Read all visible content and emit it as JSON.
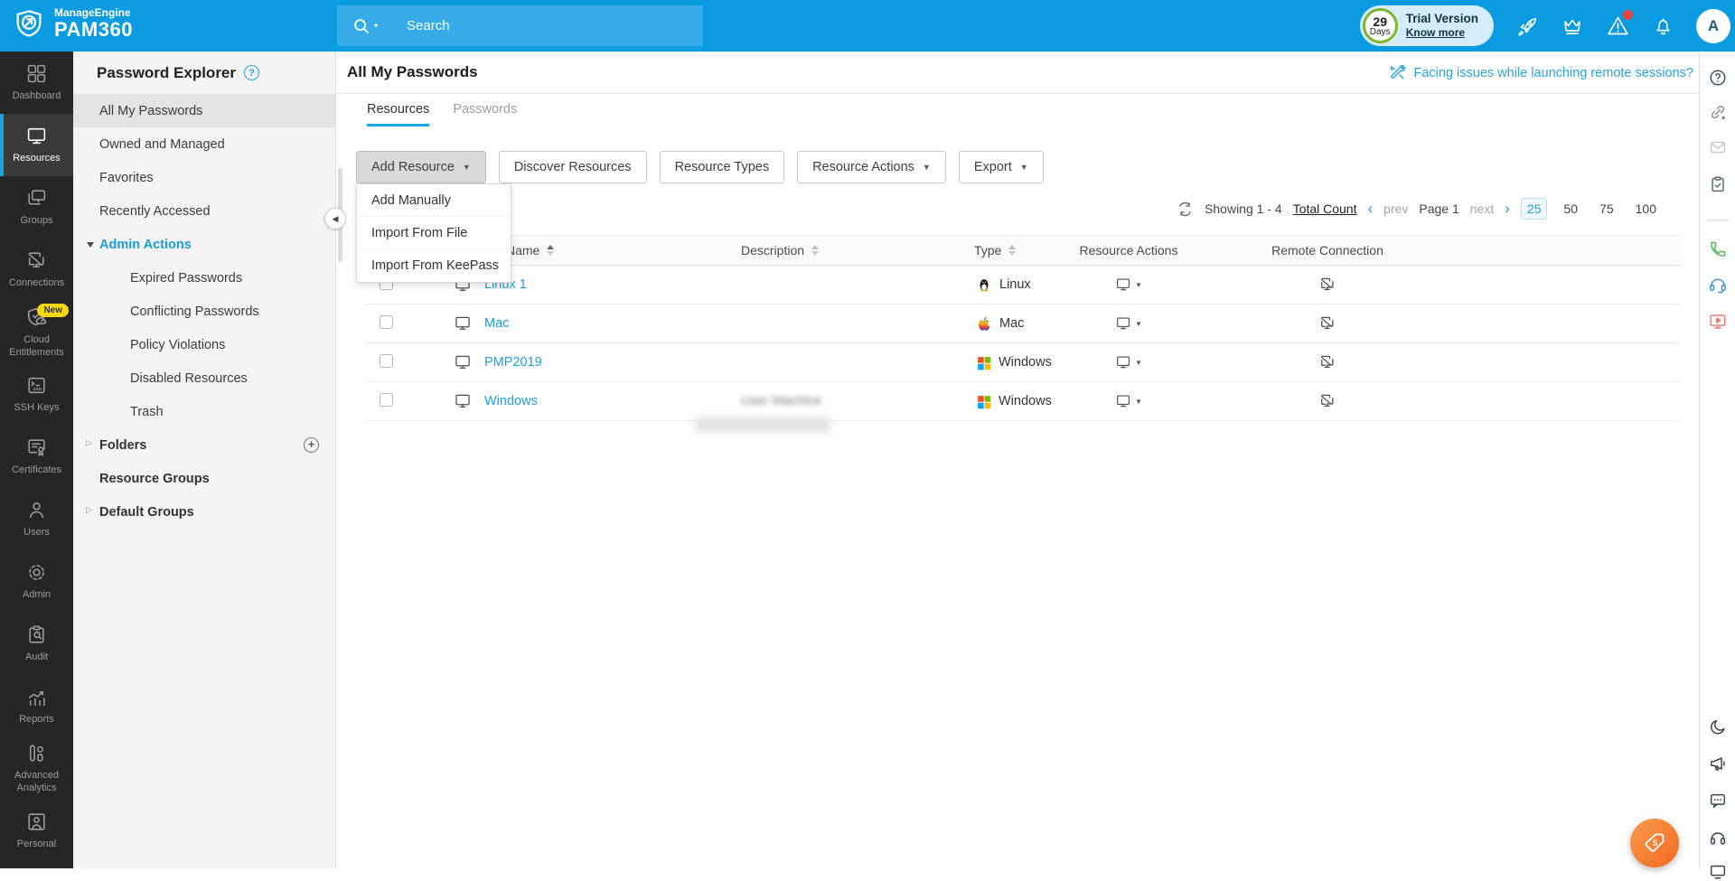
{
  "header": {
    "brand_line1": "ManageEngine",
    "brand_line2": "PAM360",
    "logo_icon": "shield-arrow-logo",
    "search_placeholder": "Search",
    "search_icon": "search-icon",
    "trial": {
      "days_value": "29",
      "days_unit": "Days",
      "label": "Trial Version",
      "link": "Know more"
    },
    "action_icons": [
      "rocket-icon",
      "crown-icon",
      "alert-icon",
      "bell-icon"
    ],
    "avatar_initial": "A",
    "colors": {
      "header_blue": "#0a9be0",
      "search_blue": "#38ace8",
      "trial_ring_green": "#7cb72e"
    }
  },
  "nav_items": [
    {
      "label": "Dashboard",
      "icon": "dashboard-icon"
    },
    {
      "label": "Resources",
      "icon": "monitor-icon",
      "active": true
    },
    {
      "label": "Groups",
      "icon": "group-monitors-icon"
    },
    {
      "label": "Connections",
      "icon": "connections-icon"
    },
    {
      "label": "Cloud Entitlements",
      "icon": "cloud-shield-icon",
      "badge": "New"
    },
    {
      "label": "SSH Keys",
      "icon": "ssh-terminal-icon"
    },
    {
      "label": "Certificates",
      "icon": "certificate-icon"
    },
    {
      "label": "Users",
      "icon": "user-icon"
    },
    {
      "label": "Admin",
      "icon": "gear-icon"
    },
    {
      "label": "Audit",
      "icon": "clipboard-search-icon"
    },
    {
      "label": "Reports",
      "icon": "chart-icon"
    },
    {
      "label": "Advanced Analytics",
      "icon": "analytics-icon"
    },
    {
      "label": "Personal",
      "icon": "person-card-icon"
    }
  ],
  "explorer": {
    "title": "Password Explorer",
    "help_icon": "help-circle-icon",
    "items": [
      {
        "label": "All My Passwords",
        "selected": true
      },
      {
        "label": "Owned and Managed"
      },
      {
        "label": "Favorites"
      },
      {
        "label": "Recently Accessed"
      },
      {
        "label": "Admin Actions",
        "expanded": true
      },
      {
        "label": "Expired Passwords",
        "child": true
      },
      {
        "label": "Conflicting Passwords",
        "child": true
      },
      {
        "label": "Policy Violations",
        "child": true
      },
      {
        "label": "Disabled Resources",
        "child": true
      },
      {
        "label": "Trash",
        "child": true
      },
      {
        "label": "Folders",
        "collapsed": true,
        "add_icon": "plus-circle-icon"
      },
      {
        "label": "Resource Groups"
      },
      {
        "label": "Default Groups",
        "collapsed": true
      }
    ]
  },
  "main": {
    "page_title": "All My Passwords",
    "banner": {
      "icon": "tools-icon",
      "text": "Facing issues while launching remote sessions?"
    },
    "tabs": {
      "resources": "Resources",
      "passwords": "Passwords"
    },
    "toolbar": {
      "add_resource": "Add Resource",
      "discover": "Discover Resources",
      "resource_types": "Resource Types",
      "resource_actions": "Resource Actions",
      "export": "Export"
    },
    "add_resource_menu": [
      "Add Manually",
      "Import From File",
      "Import From KeePass"
    ],
    "pagination": {
      "refresh_icon": "refresh-icon",
      "showing": "Showing 1 - 4",
      "total_count": "Total Count",
      "prev": "prev",
      "page": "Page 1",
      "next": "next",
      "sizes": [
        "25",
        "50",
        "75",
        "100"
      ],
      "active_size": "25"
    },
    "table": {
      "headers": {
        "name": "Name",
        "description": "Description",
        "type": "Type",
        "resource_actions": "Resource Actions",
        "remote_connection": "Remote Connection"
      },
      "rows": [
        {
          "name": "Linux 1",
          "description": "",
          "type": "Linux",
          "type_icon": "linux-penguin-icon"
        },
        {
          "name": "Mac",
          "description": "",
          "type": "Mac",
          "type_icon": "apple-icon"
        },
        {
          "name": "PMP2019",
          "description": "",
          "type": "Windows",
          "type_icon": "windows-icon"
        },
        {
          "name": "Windows",
          "description": "User Machine",
          "description_blurred": true,
          "type": "Windows",
          "type_icon": "windows-icon"
        }
      ],
      "row_icons": {
        "name_icon": "monitor-icon",
        "actions_icon": "monitor-dropdown-icon",
        "remote_icon": "remote-session-icon"
      }
    }
  },
  "side_strip": {
    "icons_top": [
      "help-circle-icon",
      "link-icon",
      "mail-icon",
      "clipboard-check-icon"
    ],
    "icons_middle": [
      "phone-icon",
      "headset-icon",
      "session-play-icon"
    ],
    "icons_bottom": [
      "dark-mode-moon-icon",
      "megaphone-icon",
      "chat-icon",
      "headphones-icon",
      "device-icon"
    ]
  },
  "fab": {
    "icon": "price-tag-icon",
    "color": "#f2691f"
  },
  "colors": {
    "accent_blue": "#1b9fe0",
    "sidebar_dark": "#262626",
    "new_badge_yellow": "#f5d711",
    "link_blue": "#2aa4dd"
  }
}
